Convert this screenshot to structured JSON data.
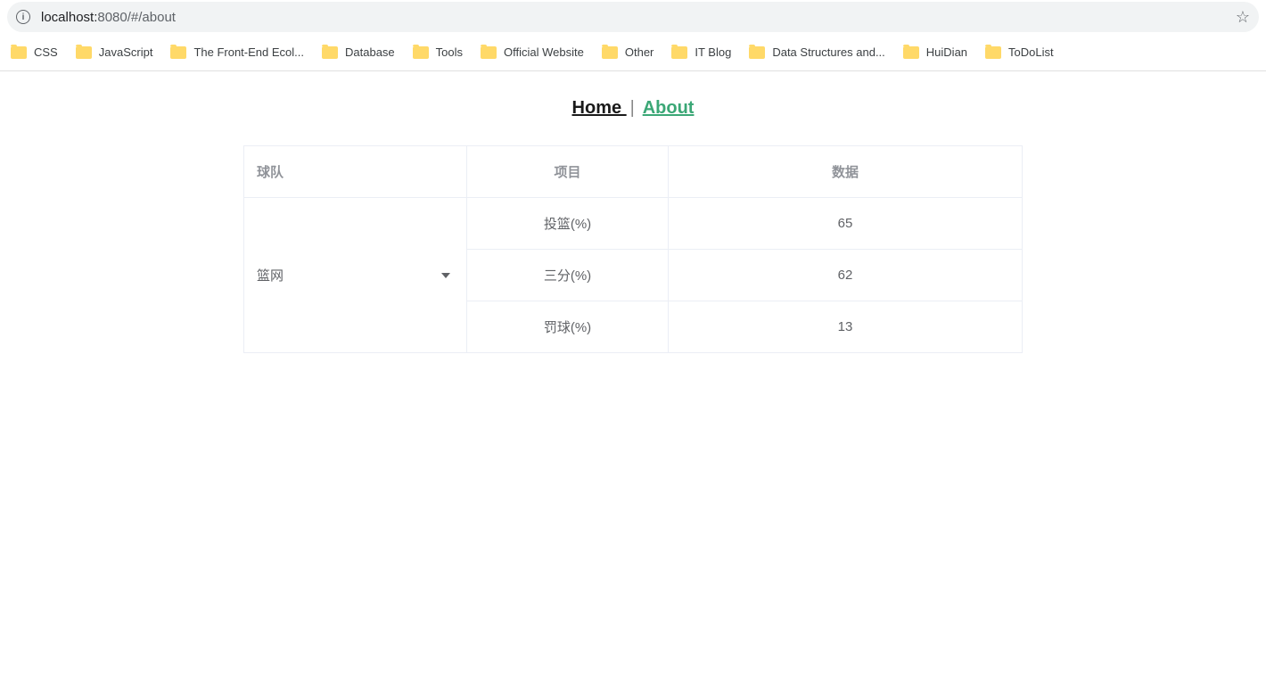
{
  "addressBar": {
    "host": "localhost:",
    "port": "8080",
    "path": "/#/about"
  },
  "bookmarks": [
    {
      "label": "CSS"
    },
    {
      "label": "JavaScript"
    },
    {
      "label": "The Front-End Ecol..."
    },
    {
      "label": "Database"
    },
    {
      "label": "Tools"
    },
    {
      "label": "Official Website"
    },
    {
      "label": "Other"
    },
    {
      "label": "IT Blog"
    },
    {
      "label": "Data Structures and..."
    },
    {
      "label": "HuiDian"
    },
    {
      "label": "ToDoList"
    }
  ],
  "nav": {
    "home": "Home ",
    "separator": "|",
    "about": "About"
  },
  "table": {
    "headers": {
      "team": "球队",
      "item": "项目",
      "data": "数据"
    },
    "teamName": "篮网",
    "rows": [
      {
        "item": "投篮(%)",
        "value": "65"
      },
      {
        "item": "三分(%)",
        "value": "62"
      },
      {
        "item": "罚球(%)",
        "value": "13"
      }
    ]
  }
}
